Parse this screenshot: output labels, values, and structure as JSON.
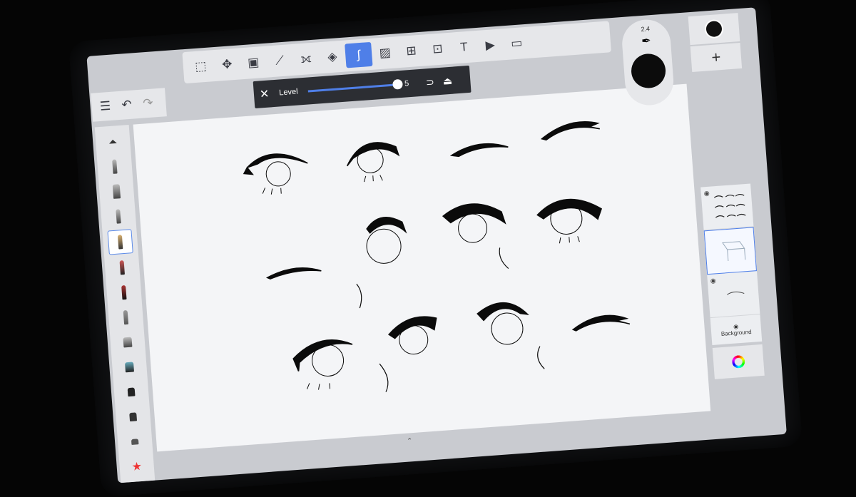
{
  "toolbar": {
    "icons": [
      "select-icon",
      "transform-icon",
      "fill-icon",
      "ruler-icon",
      "symmetry-icon",
      "shapes-icon",
      "curve-icon",
      "image-icon",
      "perspective-icon",
      "time-lapse-icon",
      "text-icon",
      "video-icon",
      "frame-icon"
    ],
    "active_tool": "curve-icon"
  },
  "mini_toolbar": {
    "icons": [
      "menu-icon",
      "undo-icon",
      "redo-icon"
    ]
  },
  "level_popup": {
    "label": "Level",
    "value": "5",
    "level_fraction": 1.0
  },
  "brush_size": {
    "value": "2.4"
  },
  "layers": {
    "background_label": "Background"
  },
  "colors": {
    "accent": "#4f7fe8",
    "current_color": "#111111"
  }
}
